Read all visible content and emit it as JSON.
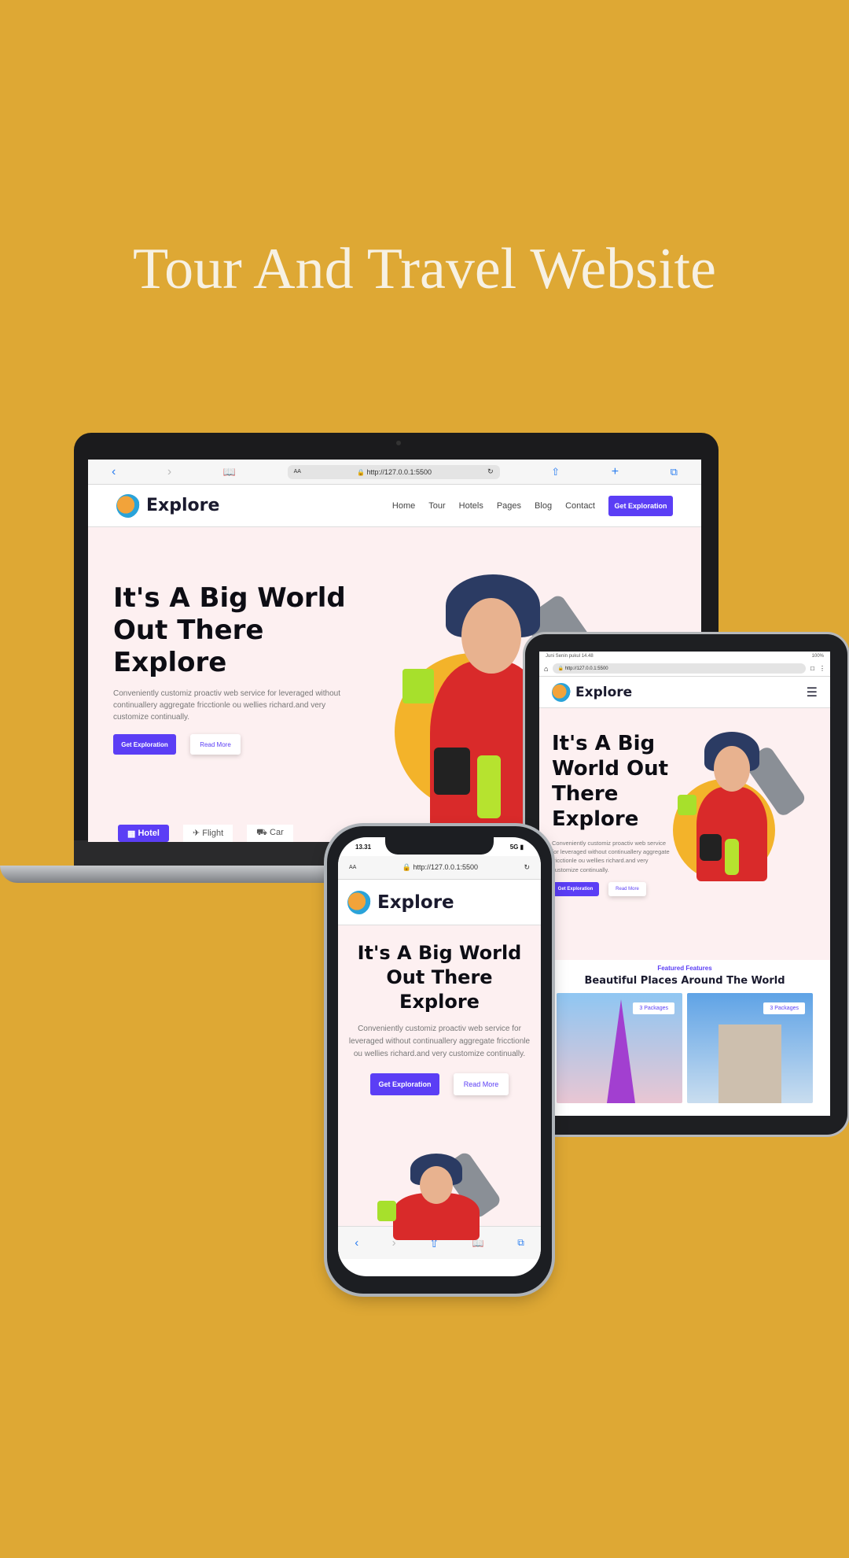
{
  "page_title": "Tour And Travel Website",
  "browser": {
    "url": "http://127.0.0.1:5500",
    "aa": "AA"
  },
  "brand": {
    "name": "Explore"
  },
  "nav": {
    "items": [
      "Home",
      "Tour",
      "Hotels",
      "Pages",
      "Blog",
      "Contact"
    ],
    "cta": "Get Exploration"
  },
  "hero": {
    "headline_l1": "It's A Big World",
    "headline_l2": "Out There",
    "headline_l3": "Explore",
    "tablet_l1": "It's A Big",
    "tablet_l2": "World Out",
    "tablet_l3": "There",
    "tablet_l4": "Explore",
    "paragraph": "Conveniently customiz proactiv web service for leveraged without continuallery aggregate fricctionle ou wellies richard.and very customize continually.",
    "primary_button": "Get Exploration",
    "secondary_button": "Read More"
  },
  "booking_tabs": [
    "Hotel",
    "Flight",
    "Car"
  ],
  "tablet_status": {
    "left": "Juni Senin pukul 14.48",
    "right": "100%"
  },
  "phone_status": {
    "time": "13.31",
    "network": "5G"
  },
  "featured": {
    "eyebrow": "Featured Features",
    "title": "Beautiful Places Around The World",
    "badge": "3 Packages"
  },
  "colors": {
    "background": "#DEA834",
    "accent": "#5b3ef5",
    "hero_bg": "#fdf0f1"
  }
}
